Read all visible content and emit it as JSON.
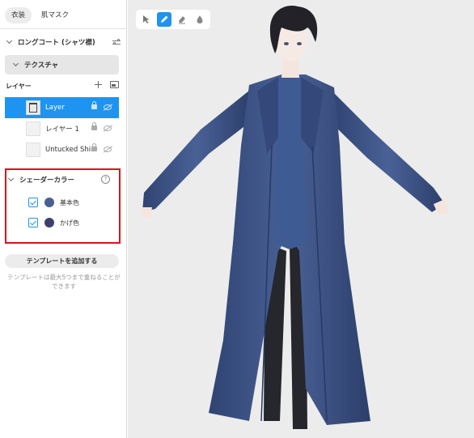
{
  "tabs": [
    {
      "label": "衣装",
      "active": true
    },
    {
      "label": "肌マスク",
      "active": false
    }
  ],
  "coat": {
    "label": "ロングコート (シャツ襟)"
  },
  "texture": {
    "label": "テクスチャ"
  },
  "layers": {
    "header": "レイヤー",
    "items": [
      {
        "label": "Layer",
        "selected": true
      },
      {
        "label": "レイヤー 1",
        "selected": false
      },
      {
        "label": "Untucked Shirt",
        "selected": false
      }
    ]
  },
  "shader": {
    "label": "シェーダーカラー",
    "help": "?",
    "colors": [
      {
        "label": "基本色",
        "checked": true,
        "color": "#4a5f8f"
      },
      {
        "label": "かげ色",
        "checked": true,
        "color": "#3c3f6e"
      }
    ]
  },
  "template": {
    "button": "テンプレートを追加する",
    "note": "テンプレートは最大5つまで重ねることができます"
  },
  "colors": {
    "accent": "#1e94f0",
    "highlight_box": "#e0101c",
    "coat": "#3b5282",
    "viewport_bg": "#ececec"
  },
  "toolbar": {
    "tools": [
      "select-tool",
      "pen-tool",
      "eraser-tool",
      "fill-tool"
    ],
    "active": "pen-tool"
  }
}
